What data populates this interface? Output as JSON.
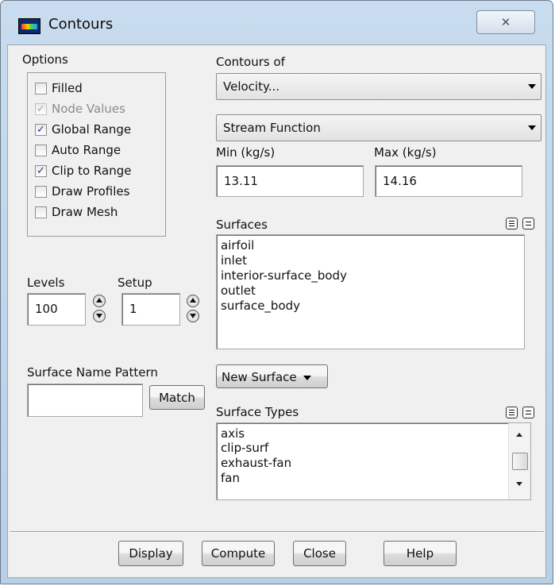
{
  "window": {
    "title": "Contours",
    "close_glyph": "✕"
  },
  "options": {
    "heading": "Options",
    "checkboxes": [
      {
        "label": "Filled",
        "checked": false,
        "enabled": true
      },
      {
        "label": "Node Values",
        "checked": true,
        "enabled": false
      },
      {
        "label": "Global Range",
        "checked": true,
        "enabled": true
      },
      {
        "label": "Auto Range",
        "checked": false,
        "enabled": true
      },
      {
        "label": "Clip to Range",
        "checked": true,
        "enabled": true
      },
      {
        "label": "Draw Profiles",
        "checked": false,
        "enabled": true
      },
      {
        "label": "Draw Mesh",
        "checked": false,
        "enabled": true
      }
    ]
  },
  "contours_of": {
    "label": "Contours of",
    "category": "Velocity...",
    "quantity": "Stream Function",
    "min_label": "Min (kg/s)",
    "max_label": "Max (kg/s)",
    "min_value": "13.11",
    "max_value": "14.16"
  },
  "levels": {
    "label": "Levels",
    "value": "100"
  },
  "setup": {
    "label": "Setup",
    "value": "1"
  },
  "surfaces": {
    "label": "Surfaces",
    "items": [
      "airfoil",
      "inlet",
      "interior-surface_body",
      "outlet",
      "surface_body"
    ]
  },
  "surface_name_pattern": {
    "label": "Surface Name Pattern",
    "value": "",
    "match_button": "Match"
  },
  "new_surface": {
    "label": "New Surface"
  },
  "surface_types": {
    "label": "Surface Types",
    "items": [
      "axis",
      "clip-surf",
      "exhaust-fan",
      "fan"
    ]
  },
  "footer": {
    "display": "Display",
    "compute": "Compute",
    "close": "Close",
    "help": "Help"
  },
  "icons": {
    "app": "fluent-contours-icon",
    "select_all": "select-all-icon",
    "deselect_all": "deselect-all-icon"
  }
}
